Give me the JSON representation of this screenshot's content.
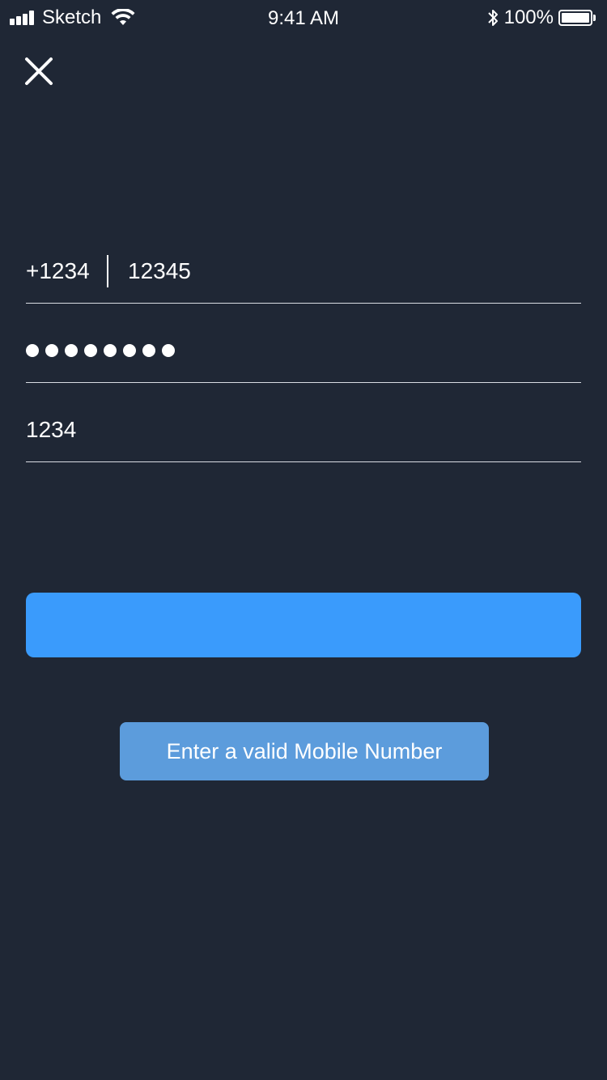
{
  "status_bar": {
    "carrier": "Sketch",
    "time": "9:41 AM",
    "battery": "100%",
    "icons": [
      "signal-icon",
      "wifi-icon",
      "bluetooth-icon",
      "battery-icon"
    ]
  },
  "header": {
    "close_icon": "close-icon"
  },
  "form": {
    "phone": {
      "country_code": "+1234",
      "number": "12345"
    },
    "password": {
      "masked_length": 8
    },
    "code": {
      "value": "1234"
    }
  },
  "primary_button": {
    "color": "#3a9bfc"
  },
  "toast": {
    "message": "Enter a valid Mobile Number"
  },
  "colors": {
    "background": "#1f2735",
    "accent": "#3a9bfc",
    "toast": "#5c9cdc"
  }
}
